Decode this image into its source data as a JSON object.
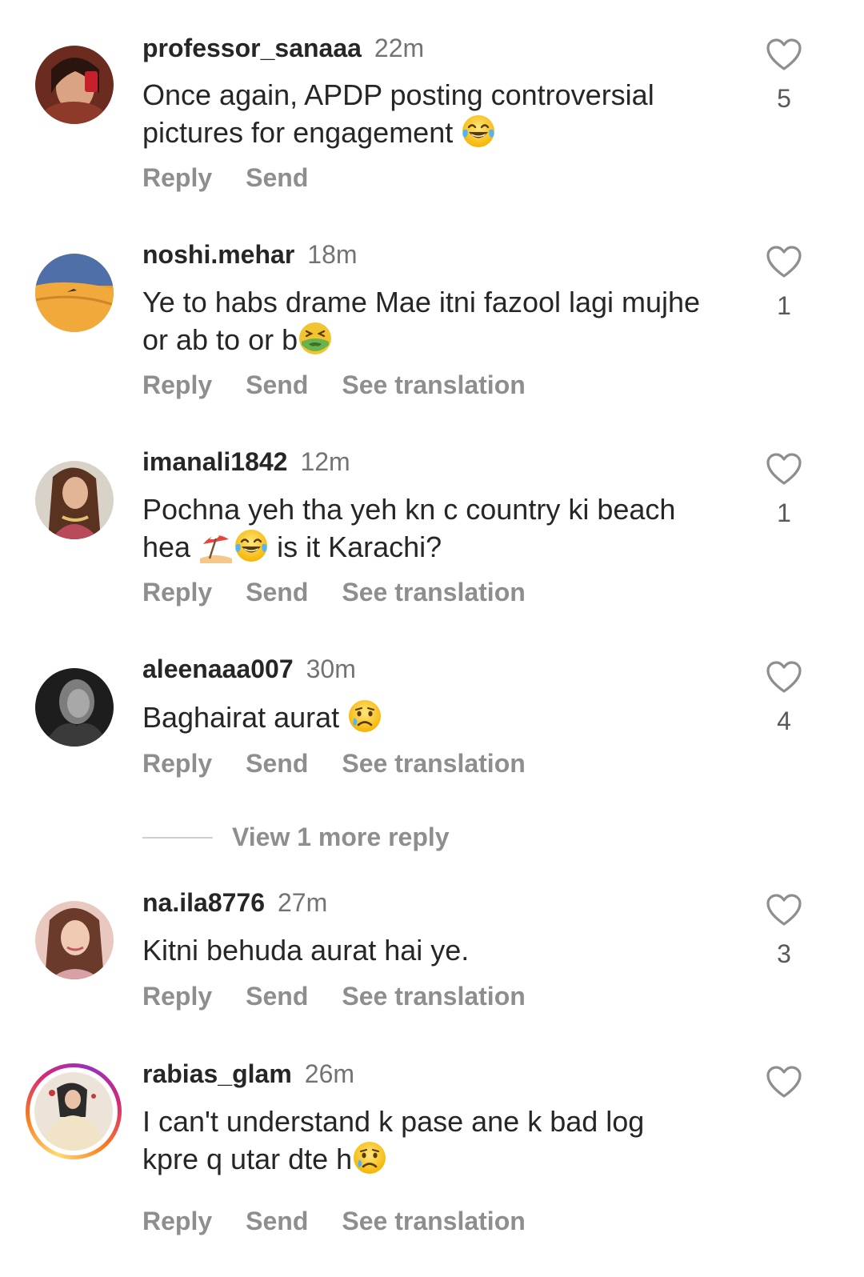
{
  "comments": [
    {
      "username": "professor_sanaaa",
      "time": "22m",
      "text_line1": "Once again, APDP posting controversial",
      "text_line2": "pictures for engagement",
      "emoji2": "joy-emoji",
      "likes": "5",
      "reply": "Reply",
      "send": "Send"
    },
    {
      "username": "noshi.mehar",
      "time": "18m",
      "text_line1": "Ye to habs drame Mae itni fazool lagi mujhe",
      "text_line2": "or ab to or b",
      "emoji2": "nauseated-emoji",
      "likes": "1",
      "reply": "Reply",
      "send": "Send",
      "translate": "See translation"
    },
    {
      "username": "imanali1842",
      "time": "12m",
      "text_line1": "Pochna yeh tha yeh kn c country ki beach",
      "text_line2a": "hea",
      "text_line2b": "is it Karachi?",
      "emoji2": "beach-umbrella-emoji joy-emoji",
      "likes": "1",
      "reply": "Reply",
      "send": "Send",
      "translate": "See translation"
    },
    {
      "username": "aleenaaa007",
      "time": "30m",
      "text_line1": "Baghairat aurat",
      "emoji1": "crying-emoji",
      "likes": "4",
      "reply": "Reply",
      "send": "Send",
      "translate": "See translation"
    },
    {
      "username": "na.ila8776",
      "time": "27m",
      "text_line1": "Kitni behuda aurat hai ye.",
      "likes": "3",
      "reply": "Reply",
      "send": "Send",
      "translate": "See translation"
    },
    {
      "username": "rabias_glam",
      "time": "26m",
      "text_line1": "I can't understand k pase ane k bad log",
      "text_line2": "kpre q utar dte h",
      "emoji2": "crying-emoji",
      "reply": "Reply",
      "send": "Send",
      "translate": "See translation"
    }
  ],
  "view_more_replies": "View 1 more reply",
  "colors": {
    "text": "#262626",
    "secondary": "#737373",
    "action": "#8e8e8e",
    "story_ring": "#d62976"
  }
}
